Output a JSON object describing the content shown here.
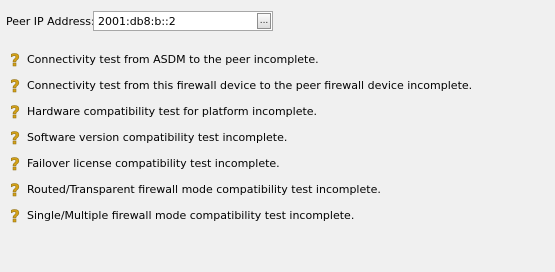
{
  "peer": {
    "label": "Peer IP Address:",
    "value": "2001:db8:b::2",
    "browse_label": "..."
  },
  "status_icon": "question-mark-icon",
  "status_icon_color": "#d4a21a",
  "tests": [
    {
      "label": "Connectivity test from ASDM to the peer incomplete."
    },
    {
      "label": "Connectivity test from this firewall device to the peer firewall device incomplete."
    },
    {
      "label": "Hardware compatibility test for platform incomplete."
    },
    {
      "label": "Software version compatibility test incomplete."
    },
    {
      "label": "Failover license compatibility test incomplete."
    },
    {
      "label": "Routed/Transparent firewall mode compatibility test incomplete."
    },
    {
      "label": "Single/Multiple firewall mode compatibility test incomplete."
    }
  ]
}
